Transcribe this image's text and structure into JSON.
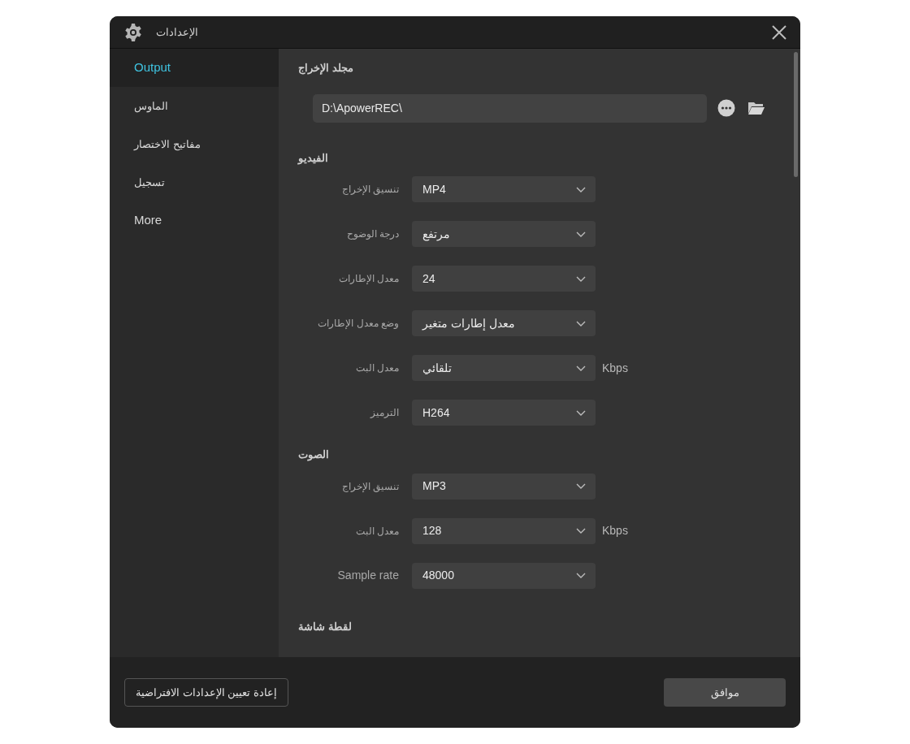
{
  "window": {
    "title": "الإعدادات"
  },
  "sidebar": {
    "items": [
      {
        "label": "Output",
        "selected": true
      },
      {
        "label": "الماوس",
        "selected": false
      },
      {
        "label": "مفاتيح الاختصار",
        "selected": false
      },
      {
        "label": "تسجيل",
        "selected": false
      },
      {
        "label": "More",
        "selected": false
      }
    ]
  },
  "output_folder": {
    "heading": "مجلد الإخراج",
    "path": "D:\\ApowerREC\\"
  },
  "sections": [
    {
      "heading": "الفيديو",
      "rows": [
        {
          "label": "تنسيق الإخراج",
          "value": "MP4"
        },
        {
          "label": "درجة الوضوح",
          "value": "مرتفع"
        },
        {
          "label": "معدل الإطارات",
          "value": "24"
        },
        {
          "label": "وضع معدل الإطارات",
          "value": "معدل إطارات متغير"
        },
        {
          "label": "معدل البت",
          "value": "تلقائي",
          "unit": "Kbps"
        },
        {
          "label": "الترميز",
          "value": "H264"
        }
      ]
    },
    {
      "heading": "الصوت",
      "rows": [
        {
          "label": "تنسيق الإخراج",
          "value": "MP3"
        },
        {
          "label": "معدل البت",
          "value": "128",
          "unit": "Kbps"
        },
        {
          "label": "Sample rate",
          "value": "48000"
        }
      ]
    },
    {
      "heading": "لقطة شاشة"
    }
  ],
  "footer": {
    "reset_button": "إعادة تعيين الإعدادات الافتراضية",
    "ok_button": "موافق"
  }
}
